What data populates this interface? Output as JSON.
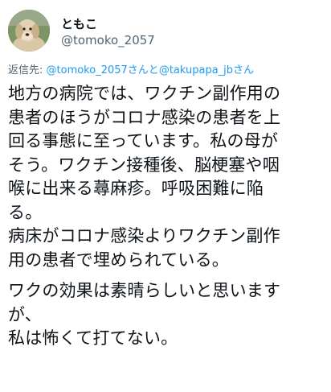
{
  "tweet": {
    "display_name": "ともこ",
    "handle": "@tomoko_2057",
    "reply": {
      "prefix": "返信先: ",
      "user1": "@tomoko_2057",
      "mid": "さんと",
      "user2": "@takupapa_jb",
      "suffix": "さん"
    },
    "body": {
      "p1": [
        "地方の病院では、ワクチン副作用の",
        "患者のほうがコロナ感染の患者を上",
        "回る事態に至っています。私の母が",
        "そう。ワクチン接種後、脳梗塞や咽",
        "喉に出来る蕁麻疹。呼吸困難に陥",
        "る。"
      ],
      "p2": [
        "病床がコロナ感染よりワクチン副作",
        "用の患者で埋められている。"
      ],
      "p3": [
        "ワクの効果は素晴らしいと思います",
        "が、",
        "私は怖くて打てない。"
      ]
    }
  },
  "colors": {
    "text": "#0f1419",
    "secondary": "#536471",
    "link": "#1d9bf0"
  },
  "icons": {
    "avatar": "dog-photo-avatar"
  }
}
